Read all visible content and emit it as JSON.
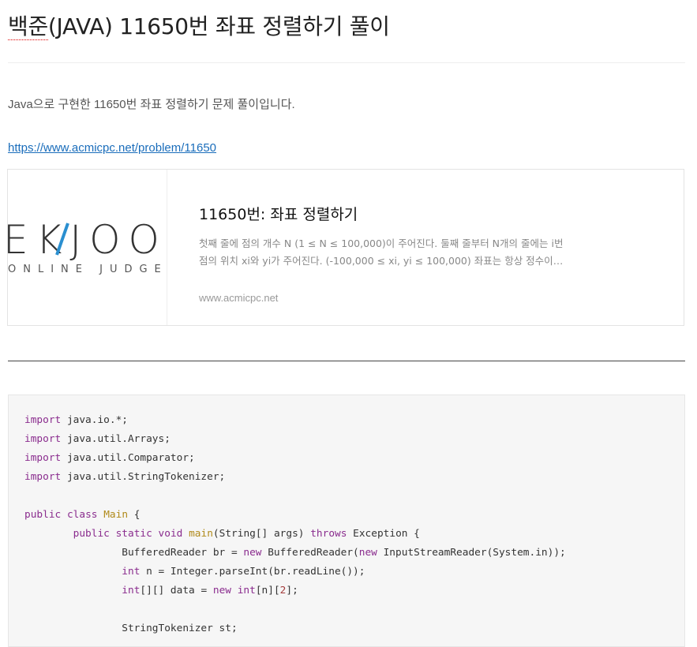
{
  "post": {
    "title": "백준(JAVA) 11650번 좌표 정렬하기 풀이",
    "title_underlined_part": "백준",
    "title_rest": "(JAVA) 11650번 좌표 정렬하기 풀이",
    "intro": "Java으로 구현한 11650번 좌표 정렬하기 문제 풀이입니다.",
    "link": "https://www.acmicpc.net/problem/11650"
  },
  "card": {
    "logo_top": "EKJOO",
    "logo_bottom": "ONLINE JUDGE",
    "title": "11650번: 좌표 정렬하기",
    "description": "첫째 줄에 점의 개수 N (1 ≤ N ≤ 100,000)이 주어진다. 둘째 줄부터 N개의 줄에는 i번점의 위치 xi와 yi가 주어진다. (-100,000 ≤ xi, yi ≤ 100,000) 좌표는 항상 정수이고, 위치가 같은 두 점은 없다.",
    "host": "www.acmicpc.net"
  },
  "colors": {
    "link": "#1a6dbb",
    "keyword": "#8a2c8e",
    "type": "#b08a1a",
    "number": "#a33a3a",
    "code_bg": "#f6f6f6"
  },
  "code": [
    [
      {
        "t": "keyword",
        "v": "import"
      },
      {
        "t": "plain",
        "v": " java.io.*;"
      }
    ],
    [
      {
        "t": "keyword",
        "v": "import"
      },
      {
        "t": "plain",
        "v": " java.util.Arrays;"
      }
    ],
    [
      {
        "t": "keyword",
        "v": "import"
      },
      {
        "t": "plain",
        "v": " java.util.Comparator;"
      }
    ],
    [
      {
        "t": "keyword",
        "v": "import"
      },
      {
        "t": "plain",
        "v": " java.util.StringTokenizer;"
      }
    ],
    [],
    [
      {
        "t": "keyword",
        "v": "public"
      },
      {
        "t": "plain",
        "v": " "
      },
      {
        "t": "keyword",
        "v": "class"
      },
      {
        "t": "plain",
        "v": " "
      },
      {
        "t": "type",
        "v": "Main"
      },
      {
        "t": "plain",
        "v": " {"
      }
    ],
    [
      {
        "t": "plain",
        "v": "        "
      },
      {
        "t": "keyword",
        "v": "public"
      },
      {
        "t": "plain",
        "v": " "
      },
      {
        "t": "keyword",
        "v": "static"
      },
      {
        "t": "plain",
        "v": " "
      },
      {
        "t": "keyword",
        "v": "void"
      },
      {
        "t": "plain",
        "v": " "
      },
      {
        "t": "func",
        "v": "main"
      },
      {
        "t": "plain",
        "v": "(String[] args) "
      },
      {
        "t": "keyword",
        "v": "throws"
      },
      {
        "t": "plain",
        "v": " Exception {"
      }
    ],
    [
      {
        "t": "plain",
        "v": "                BufferedReader br = "
      },
      {
        "t": "keyword",
        "v": "new"
      },
      {
        "t": "plain",
        "v": " BufferedReader("
      },
      {
        "t": "keyword",
        "v": "new"
      },
      {
        "t": "plain",
        "v": " InputStreamReader(System.in));"
      }
    ],
    [
      {
        "t": "plain",
        "v": "                "
      },
      {
        "t": "keyword",
        "v": "int"
      },
      {
        "t": "plain",
        "v": " n = Integer.parseInt(br.readLine());"
      }
    ],
    [
      {
        "t": "plain",
        "v": "                "
      },
      {
        "t": "keyword",
        "v": "int"
      },
      {
        "t": "plain",
        "v": "[][] data = "
      },
      {
        "t": "keyword",
        "v": "new"
      },
      {
        "t": "plain",
        "v": " "
      },
      {
        "t": "keyword",
        "v": "int"
      },
      {
        "t": "plain",
        "v": "[n]["
      },
      {
        "t": "number",
        "v": "2"
      },
      {
        "t": "plain",
        "v": "];"
      }
    ],
    [],
    [
      {
        "t": "plain",
        "v": "                StringTokenizer st;"
      }
    ]
  ]
}
